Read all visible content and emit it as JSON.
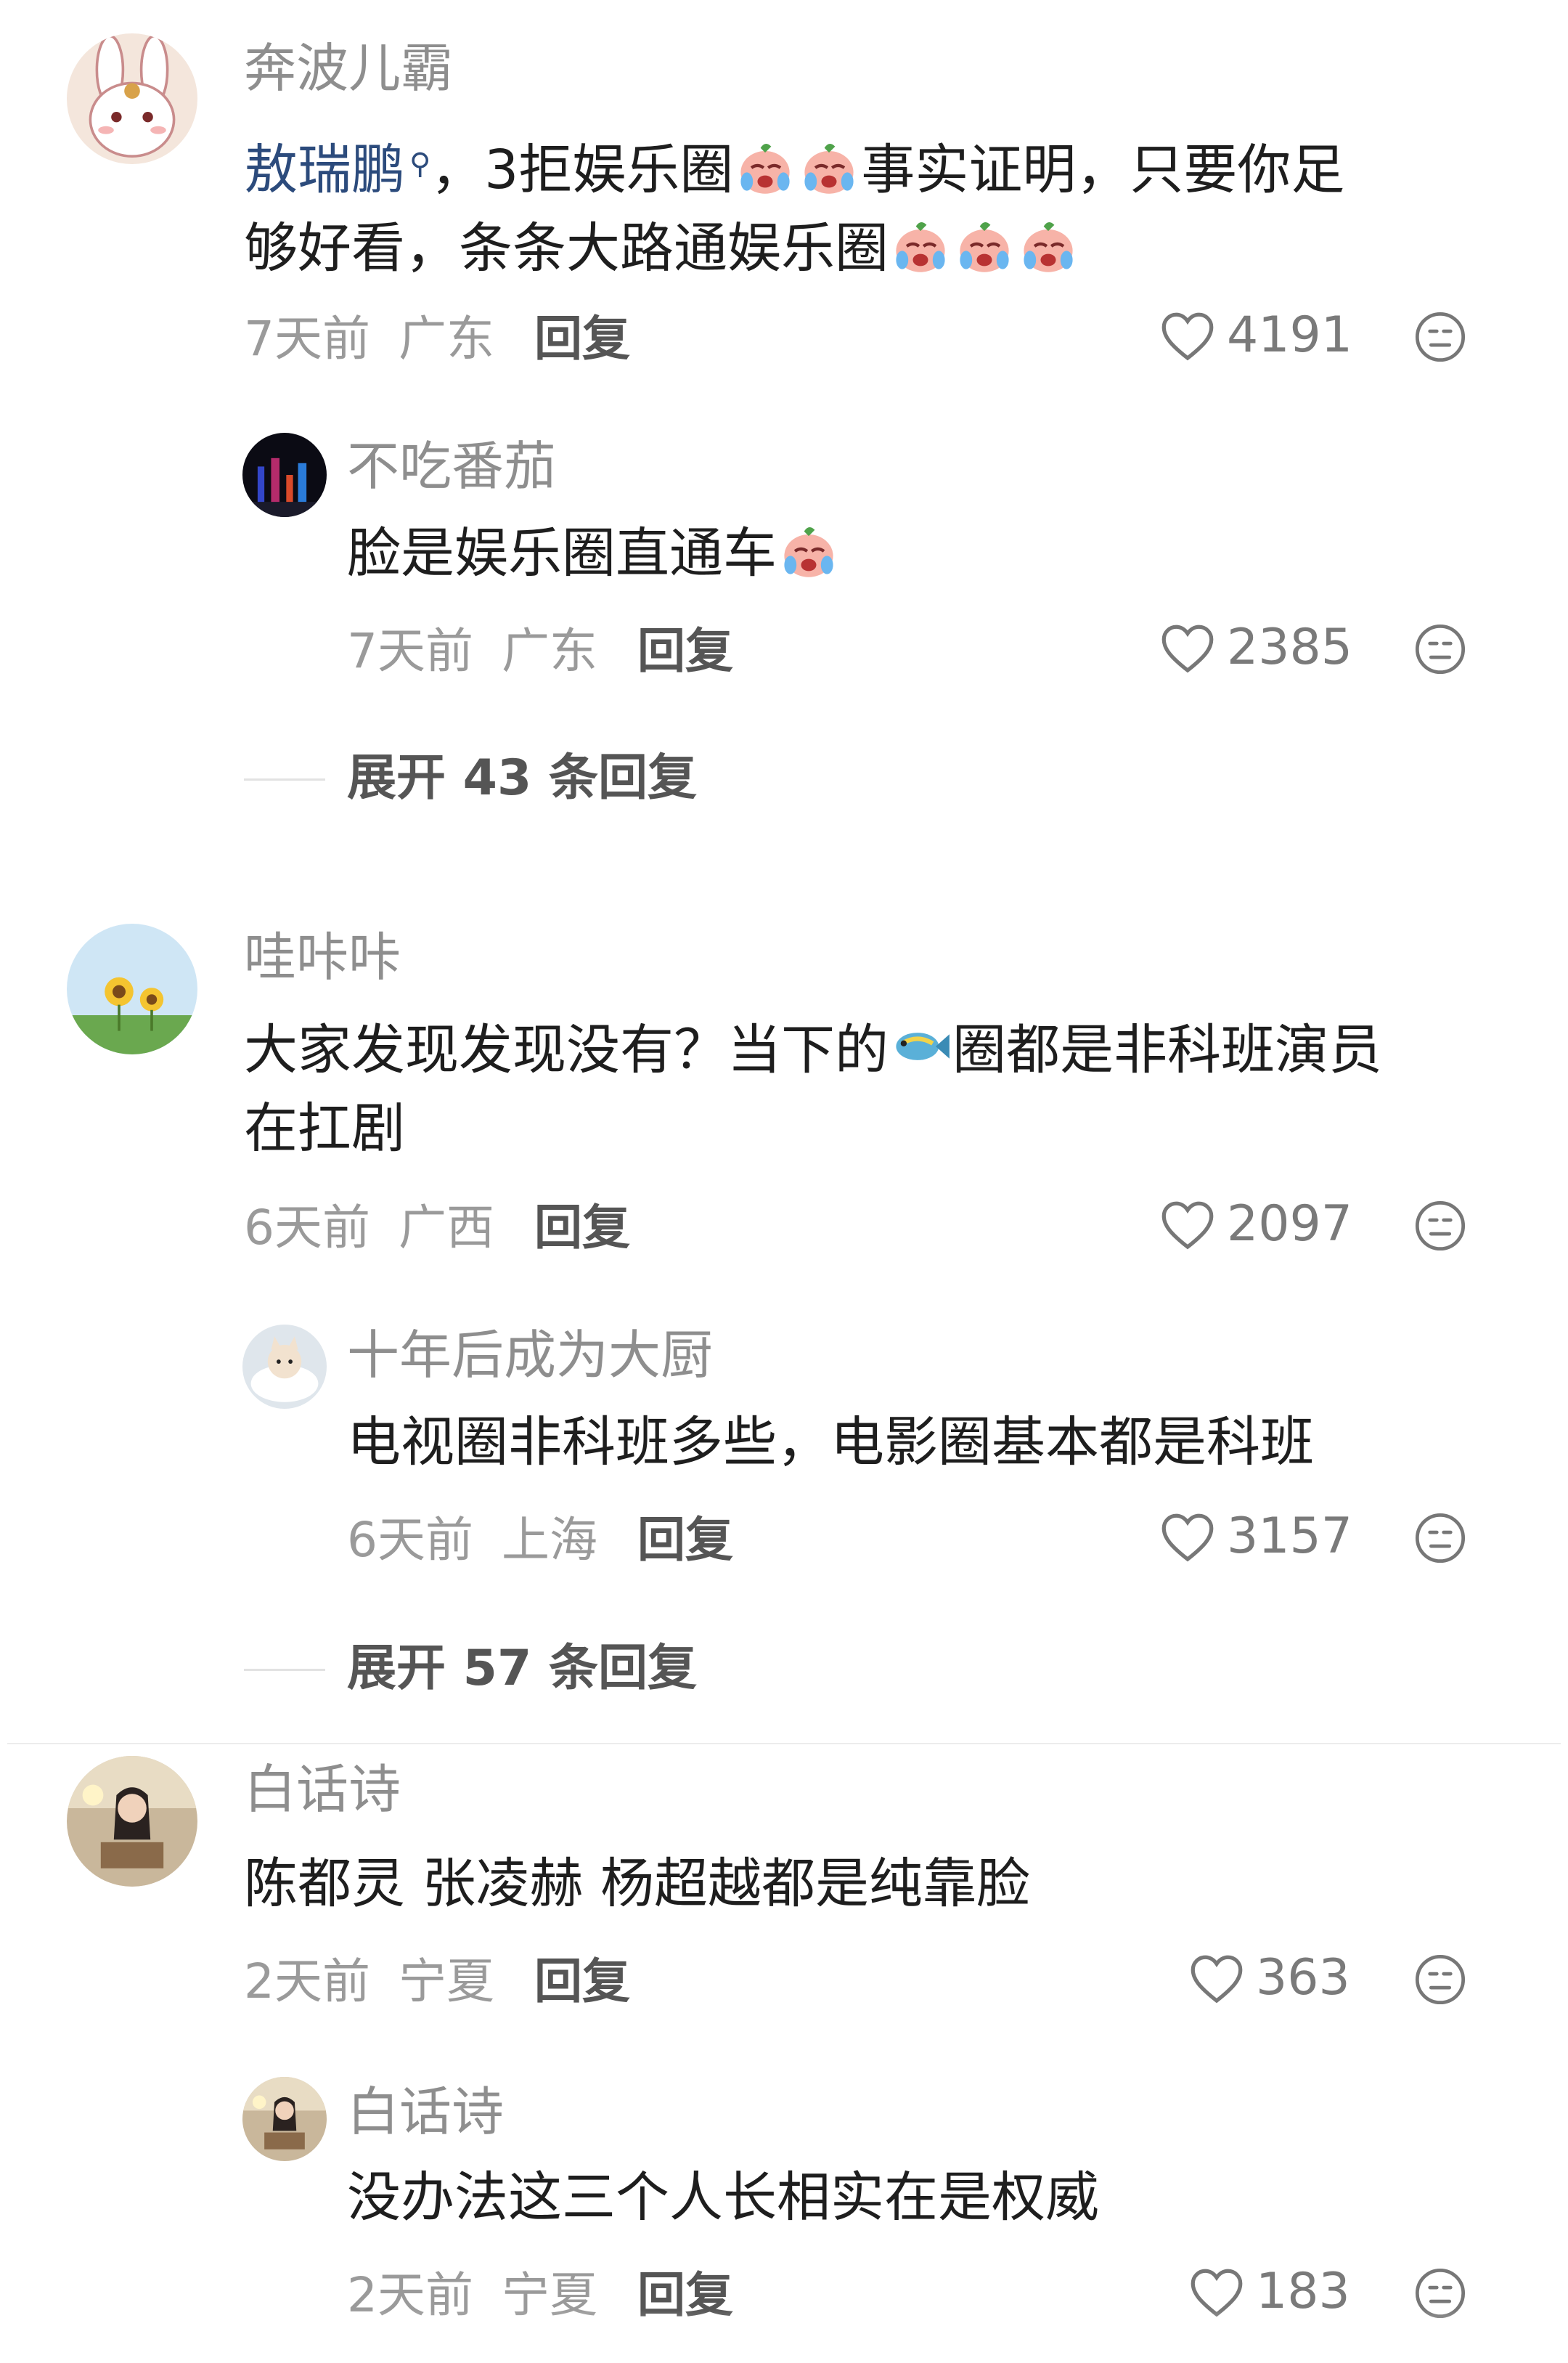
{
  "comments": [
    {
      "user": "奔波儿霸",
      "text_mention": "敖瑞鹏",
      "text_line1_after_mention": "，3拒娱乐圈",
      "text_line1_tail": "事实证明，只要你足",
      "text_line2": "够好看，条条大路通娱乐圈",
      "time": "7天前",
      "location": "广东",
      "reply_label": "回复",
      "likes": "4191",
      "replies": [
        {
          "user": "不吃番茄",
          "text": "脸是娱乐圈直通车",
          "time": "7天前",
          "location": "广东",
          "reply_label": "回复",
          "likes": "2385"
        }
      ],
      "expand_label": "展开 43 条回复"
    },
    {
      "user": "哇咔咔",
      "text_line1_head": "大家发现发现没有？当下的",
      "text_line1_tail": "圈都是非科班演员",
      "text_line2": "在扛剧",
      "time": "6天前",
      "location": "广西",
      "reply_label": "回复",
      "likes": "2097",
      "replies": [
        {
          "user": "十年后成为大厨",
          "text": "电视圈非科班多些，电影圈基本都是科班",
          "time": "6天前",
          "location": "上海",
          "reply_label": "回复",
          "likes": "3157"
        }
      ],
      "expand_label": "展开 57 条回复"
    },
    {
      "user": "白话诗",
      "text": "陈都灵 张凌赫 杨超越都是纯靠脸",
      "time": "2天前",
      "location": "宁夏",
      "reply_label": "回复",
      "likes": "363",
      "replies": [
        {
          "user": "白话诗",
          "text": "没办法这三个人长相实在是权威",
          "time": "2天前",
          "location": "宁夏",
          "reply_label": "回复",
          "likes": "183"
        }
      ]
    }
  ],
  "icons": {
    "like": "heart-outline-icon",
    "dislike": "unhappy-face-icon",
    "mention": "search-icon",
    "emoji_cry": "crying-peach-emoji",
    "emoji_fish": "fish-emoji"
  },
  "colors": {
    "text": "#1e1e1e",
    "username": "#8e8e8e",
    "meta": "#9a9a9a",
    "mention": "#2c4b7c"
  }
}
